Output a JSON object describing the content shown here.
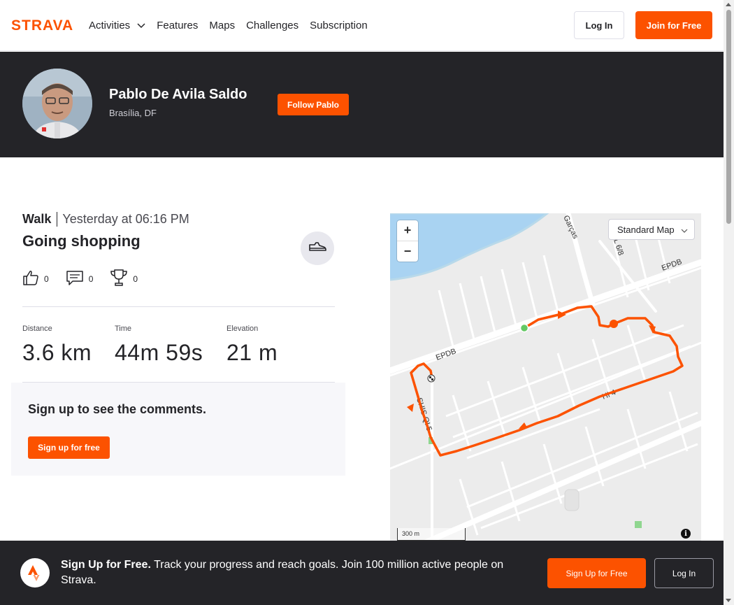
{
  "nav": {
    "logo_text": "STRAVA",
    "links": [
      "Activities",
      "Features",
      "Maps",
      "Challenges",
      "Subscription"
    ],
    "login_label": "Log In",
    "join_label": "Join for Free"
  },
  "athlete": {
    "name": "Pablo De Avila Saldo",
    "location": "Brasília, DF",
    "follow_label": "Follow Pablo"
  },
  "activity": {
    "type": "Walk",
    "date": "Yesterday at 06:16 PM",
    "title": "Going shopping",
    "kudos": "0",
    "comments": "0",
    "achievements": "0",
    "stats": [
      {
        "label": "Distance",
        "value": "3.6 km"
      },
      {
        "label": "Time",
        "value": "44m 59s"
      },
      {
        "label": "Elevation",
        "value": "21 m"
      }
    ]
  },
  "comments": {
    "prompt": "Sign up to see the comments.",
    "button_label": "Sign up for free"
  },
  "map": {
    "style_label": "Standard Map",
    "scale_label": "300 m",
    "zoom_in": "+",
    "zoom_out": "−",
    "street_labels": [
      "EPDB",
      "EPDB",
      "HI 4",
      "SHIS QI 5",
      "L 6/8",
      "Garças"
    ],
    "route_color": "#fc5200"
  },
  "bottom_bar": {
    "headline": "Sign Up for Free.",
    "body": "Track your progress and reach goals. Join 100 million active people on Strava.",
    "signup_label": "Sign Up for Free",
    "login_label": "Log In"
  },
  "colors": {
    "brand": "#fc5200",
    "dark": "#242428"
  }
}
